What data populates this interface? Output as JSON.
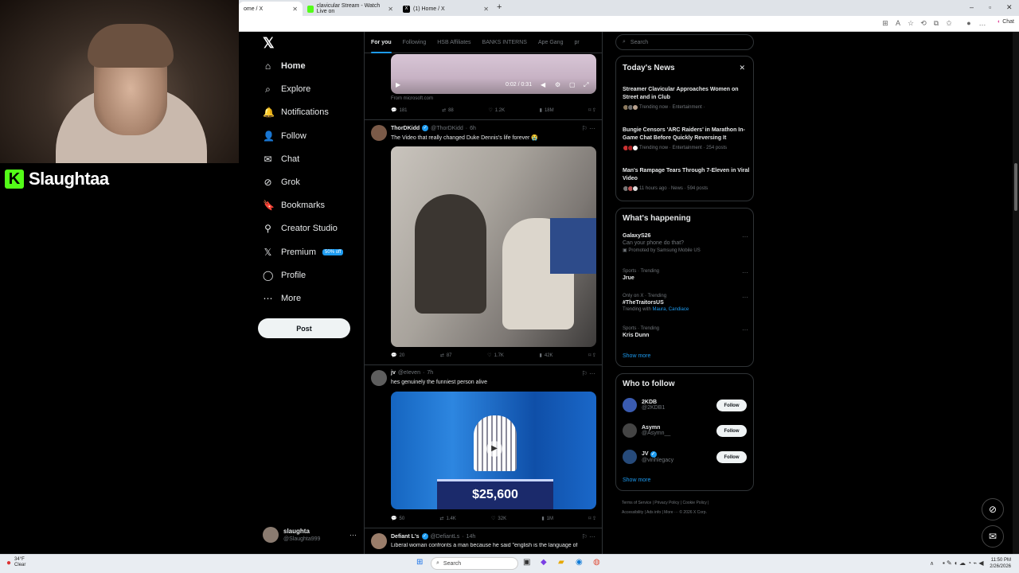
{
  "browser": {
    "tabs": [
      {
        "title": "ome / X",
        "active": true
      },
      {
        "title": "clavicular Stream - Watch Live on",
        "active": false
      },
      {
        "title": "(1) Home / X",
        "active": false
      }
    ],
    "new_tab_icon": "plus-icon",
    "chat_label": "Chat"
  },
  "stream_overlay": {
    "name": "Slaughtaa",
    "logo_letter": "K"
  },
  "nav": {
    "items": [
      {
        "label": "Home",
        "icon": "home-icon",
        "bold": true
      },
      {
        "label": "Explore",
        "icon": "search-icon"
      },
      {
        "label": "Notifications",
        "icon": "bell-icon"
      },
      {
        "label": "Follow",
        "icon": "follow-icon"
      },
      {
        "label": "Chat",
        "icon": "mail-icon"
      },
      {
        "label": "Grok",
        "icon": "grok-icon"
      },
      {
        "label": "Bookmarks",
        "icon": "bookmark-icon"
      },
      {
        "label": "Creator Studio",
        "icon": "creator-icon"
      },
      {
        "label": "Premium",
        "icon": "x-icon",
        "badge": "50% off"
      },
      {
        "label": "Profile",
        "icon": "profile-icon"
      },
      {
        "label": "More",
        "icon": "more-icon"
      }
    ],
    "post_label": "Post",
    "account": {
      "name": "slaughta",
      "handle": "@Slaughta999"
    }
  },
  "feed": {
    "tabs": [
      "For you",
      "Following",
      "HSB Affiliates",
      "BANKS INTERNS",
      "Ape Gang",
      "pr"
    ],
    "top_video": {
      "time": "0:02 / 0:31",
      "source": "From microsoft.com",
      "replies": "181",
      "reposts": "88",
      "likes": "1.2K",
      "views": "18M"
    },
    "posts": [
      {
        "name": "ThorDKidd",
        "verified": true,
        "handle": "@ThorDKidd",
        "time": "6h",
        "text": "The Video that really changed Duke Dennis's life forever 😭",
        "replies": "20",
        "reposts": "87",
        "likes": "1.7K",
        "views": "42K"
      },
      {
        "name": "jv",
        "verified": false,
        "handle": "@eIeven",
        "time": "7h",
        "text": "hes genuinely the funniest person alive",
        "media_text": "$25,600",
        "replies": "50",
        "reposts": "1.4K",
        "likes": "32K",
        "views": "1M"
      },
      {
        "name": "Defiant L's",
        "verified": true,
        "handle": "@DefiantLs",
        "time": "14h",
        "text": "Liberal woman confronts a man because he said \"english is the language of"
      }
    ]
  },
  "right": {
    "search_placeholder": "Search",
    "news_title": "Today's News",
    "news": [
      {
        "title": "Streamer Clavicular Approaches Women on Street and in Club",
        "meta": "Trending now · Entertainment ·"
      },
      {
        "title": "Bungie Censors 'ARC Raiders' in Marathon In-Game Chat Before Quickly Reversing It",
        "meta": "Trending now · Entertainment · 254 posts"
      },
      {
        "title": "Man's Rampage Tears Through 7-Eleven in Viral Video",
        "meta": "11 hours ago · News · 594 posts"
      }
    ],
    "happening_title": "What's happening",
    "happening": [
      {
        "context": "",
        "title": "GalaxyS26",
        "desc": "Can your phone do that?",
        "promo": "Promoted by Samsung Mobile US"
      },
      {
        "context": "Sports · Trending",
        "title": "Jrue"
      },
      {
        "context": "Only on X · Trending",
        "title": "#TheTraitorsUS",
        "trending_with": "Trending with",
        "tw_names": "Maura, Candiace"
      },
      {
        "context": "Sports · Trending",
        "title": "Kris Dunn"
      }
    ],
    "show_more": "Show more",
    "who_title": "Who to follow",
    "who": [
      {
        "name": "2KDB",
        "handle": "@2KDB1"
      },
      {
        "name": "Asymn",
        "handle": "@Asymn__"
      },
      {
        "name": "JV",
        "handle": "@vinhlegacy"
      }
    ],
    "follow_label": "Follow",
    "footer": {
      "l1": "Terms of Service  |  Privacy Policy  |  Cookie Policy  |",
      "l2": "Accessibility  |  Ads info  |  More ···  © 2026 X Corp."
    }
  },
  "taskbar": {
    "temp": "34°F",
    "cond": "Clear",
    "search": "Search",
    "time": "11:50 PM",
    "date": "2/26/2026"
  }
}
